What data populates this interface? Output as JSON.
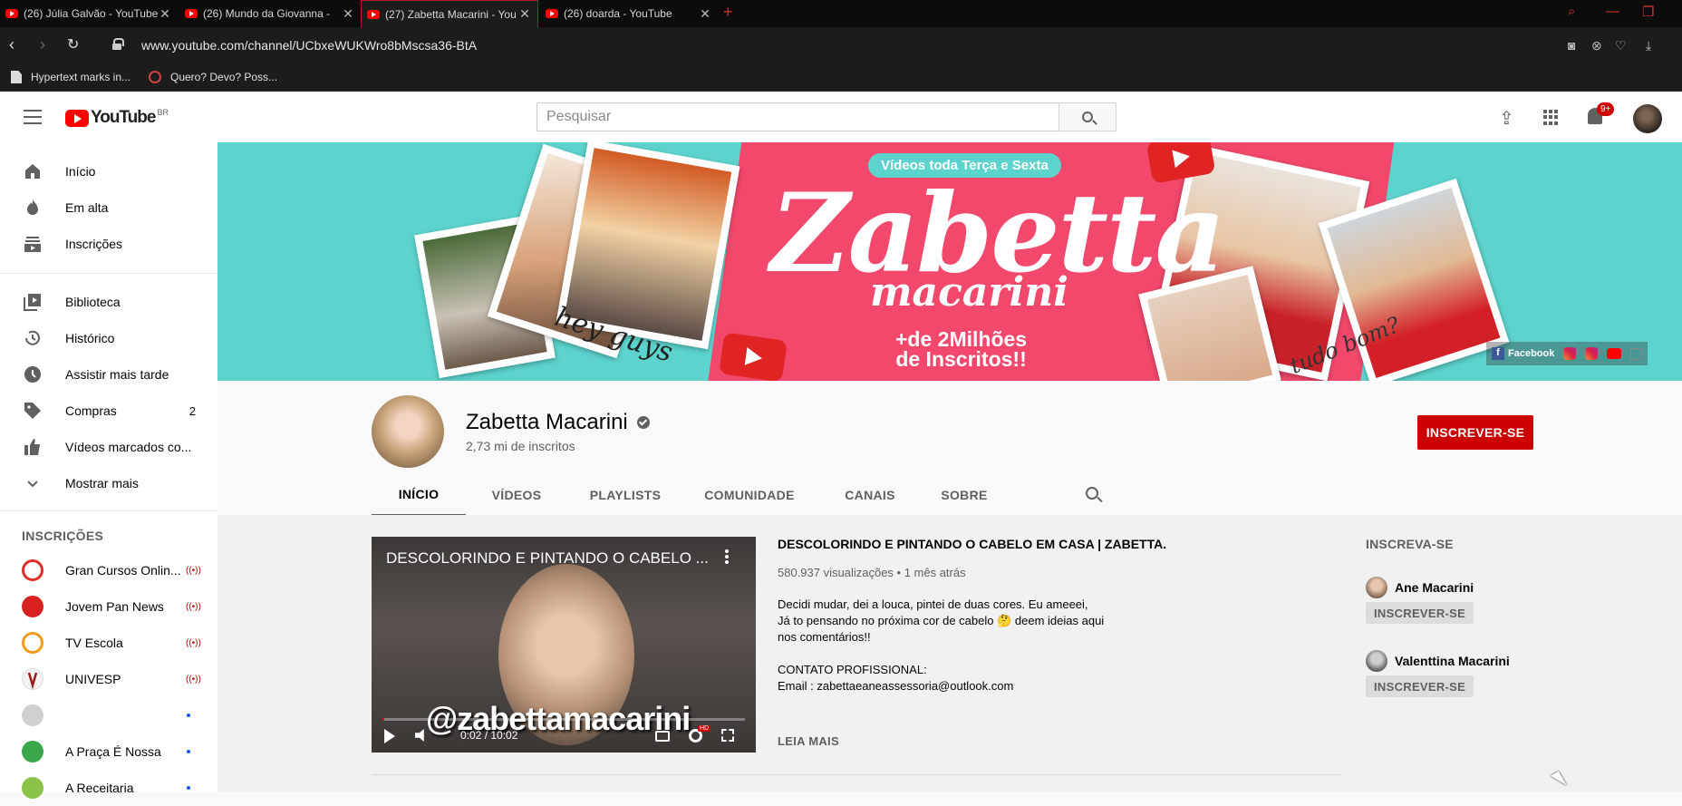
{
  "browser": {
    "tabs": [
      {
        "title": "(26) Júlia Galvão - YouTube"
      },
      {
        "title": "(26) Mundo da Giovanna -"
      },
      {
        "title": "(27) Zabetta Macarini - You"
      },
      {
        "title": "(26) doarda - YouTube"
      }
    ],
    "url": "www.youtube.com/channel/UCbxeWUKWro8bMscsa36-BtA",
    "bookmarks": [
      {
        "label": "Hypertext marks in..."
      },
      {
        "label": "Quero? Devo? Poss..."
      }
    ],
    "colors": {
      "accent": "#b31535",
      "chrome_bg": "#1c1c1c"
    }
  },
  "yt_header": {
    "logo_text": "YouTube",
    "country_code": "BR",
    "search_placeholder": "Pesquisar",
    "notification_badge": "9+"
  },
  "sidebar": {
    "main": [
      {
        "label": "Início",
        "icon": "home-icon"
      },
      {
        "label": "Em alta",
        "icon": "fire-icon"
      },
      {
        "label": "Inscrições",
        "icon": "subscriptions-icon"
      }
    ],
    "library": [
      {
        "label": "Biblioteca",
        "icon": "library-icon"
      },
      {
        "label": "Histórico",
        "icon": "history-icon"
      },
      {
        "label": "Assistir mais tarde",
        "icon": "clock-icon"
      },
      {
        "label": "Compras",
        "icon": "tag-icon",
        "count": "2"
      },
      {
        "label": "Vídeos marcados co...",
        "icon": "thumbs-up-icon"
      },
      {
        "label": "Mostrar mais",
        "icon": "chevron-down-icon"
      }
    ],
    "subscriptions_heading": "INSCRIÇÕES",
    "subscriptions": [
      {
        "name": "Gran Cursos Onlin...",
        "status": "live",
        "color": "#e0302a"
      },
      {
        "name": "Jovem Pan News",
        "status": "live",
        "color": "#d82020"
      },
      {
        "name": "TV Escola",
        "status": "live",
        "color": "#f29b1e"
      },
      {
        "name": "UNIVESP",
        "status": "live",
        "color": "#9b1b1b"
      },
      {
        "name": "",
        "status": "new",
        "color": "#c8c8c8"
      },
      {
        "name": "A Praça É Nossa",
        "status": "new",
        "color": "#3aa84a"
      },
      {
        "name": "A Receitaria",
        "status": "new",
        "color": "#8bc34a"
      }
    ]
  },
  "banner": {
    "pill_text": "Vídeos toda Terça e Sexta",
    "name_line1": "Zabetta",
    "name_line2": "macarini",
    "subs_line1": "+de 2Milhões",
    "subs_line2": "de Inscritos!!",
    "hey": "hey guys",
    "tudo": "tudo bom?",
    "links": {
      "facebook": "Facebook"
    },
    "colors": {
      "teal": "#5dd3cd",
      "pink": "#f2486b"
    }
  },
  "channel": {
    "name": "Zabetta Macarini",
    "subscribers": "2,73 mi de inscritos",
    "subscribe_label": "INSCREVER-SE",
    "tabs": [
      "INÍCIO",
      "VÍDEOS",
      "PLAYLISTS",
      "COMUNIDADE",
      "CANAIS",
      "SOBRE"
    ],
    "active_tab": "INÍCIO"
  },
  "featured": {
    "player_title": "DESCOLORINDO E PINTANDO O CABELO ...",
    "watermark": "@zabettamacarini",
    "time": "0:02 / 10:02",
    "progress_fraction": 0.0033,
    "title": "DESCOLORINDO E PINTANDO O CABELO EM CASA | ZABETTA...",
    "meta": "580.937 visualizações • 1 mês atrás",
    "description": "Decidi mudar,  dei a louca,  pintei de duas cores. Eu ameeei,\n Já to pensando no próxima cor de cabelo 🤔 deem ideias aqui\nnos comentários!!\n\nCONTATO PROFISSIONAL:\nEmail :  zabettaeaneassessoria@outlook.com",
    "read_more": "LEIA MAIS"
  },
  "related": {
    "heading": "INSCREVA-SE",
    "channels": [
      {
        "name": "Ane Macarini",
        "button": "INSCREVER-SE"
      },
      {
        "name": "Valenttina Macarini",
        "button": "INSCREVER-SE"
      }
    ]
  }
}
